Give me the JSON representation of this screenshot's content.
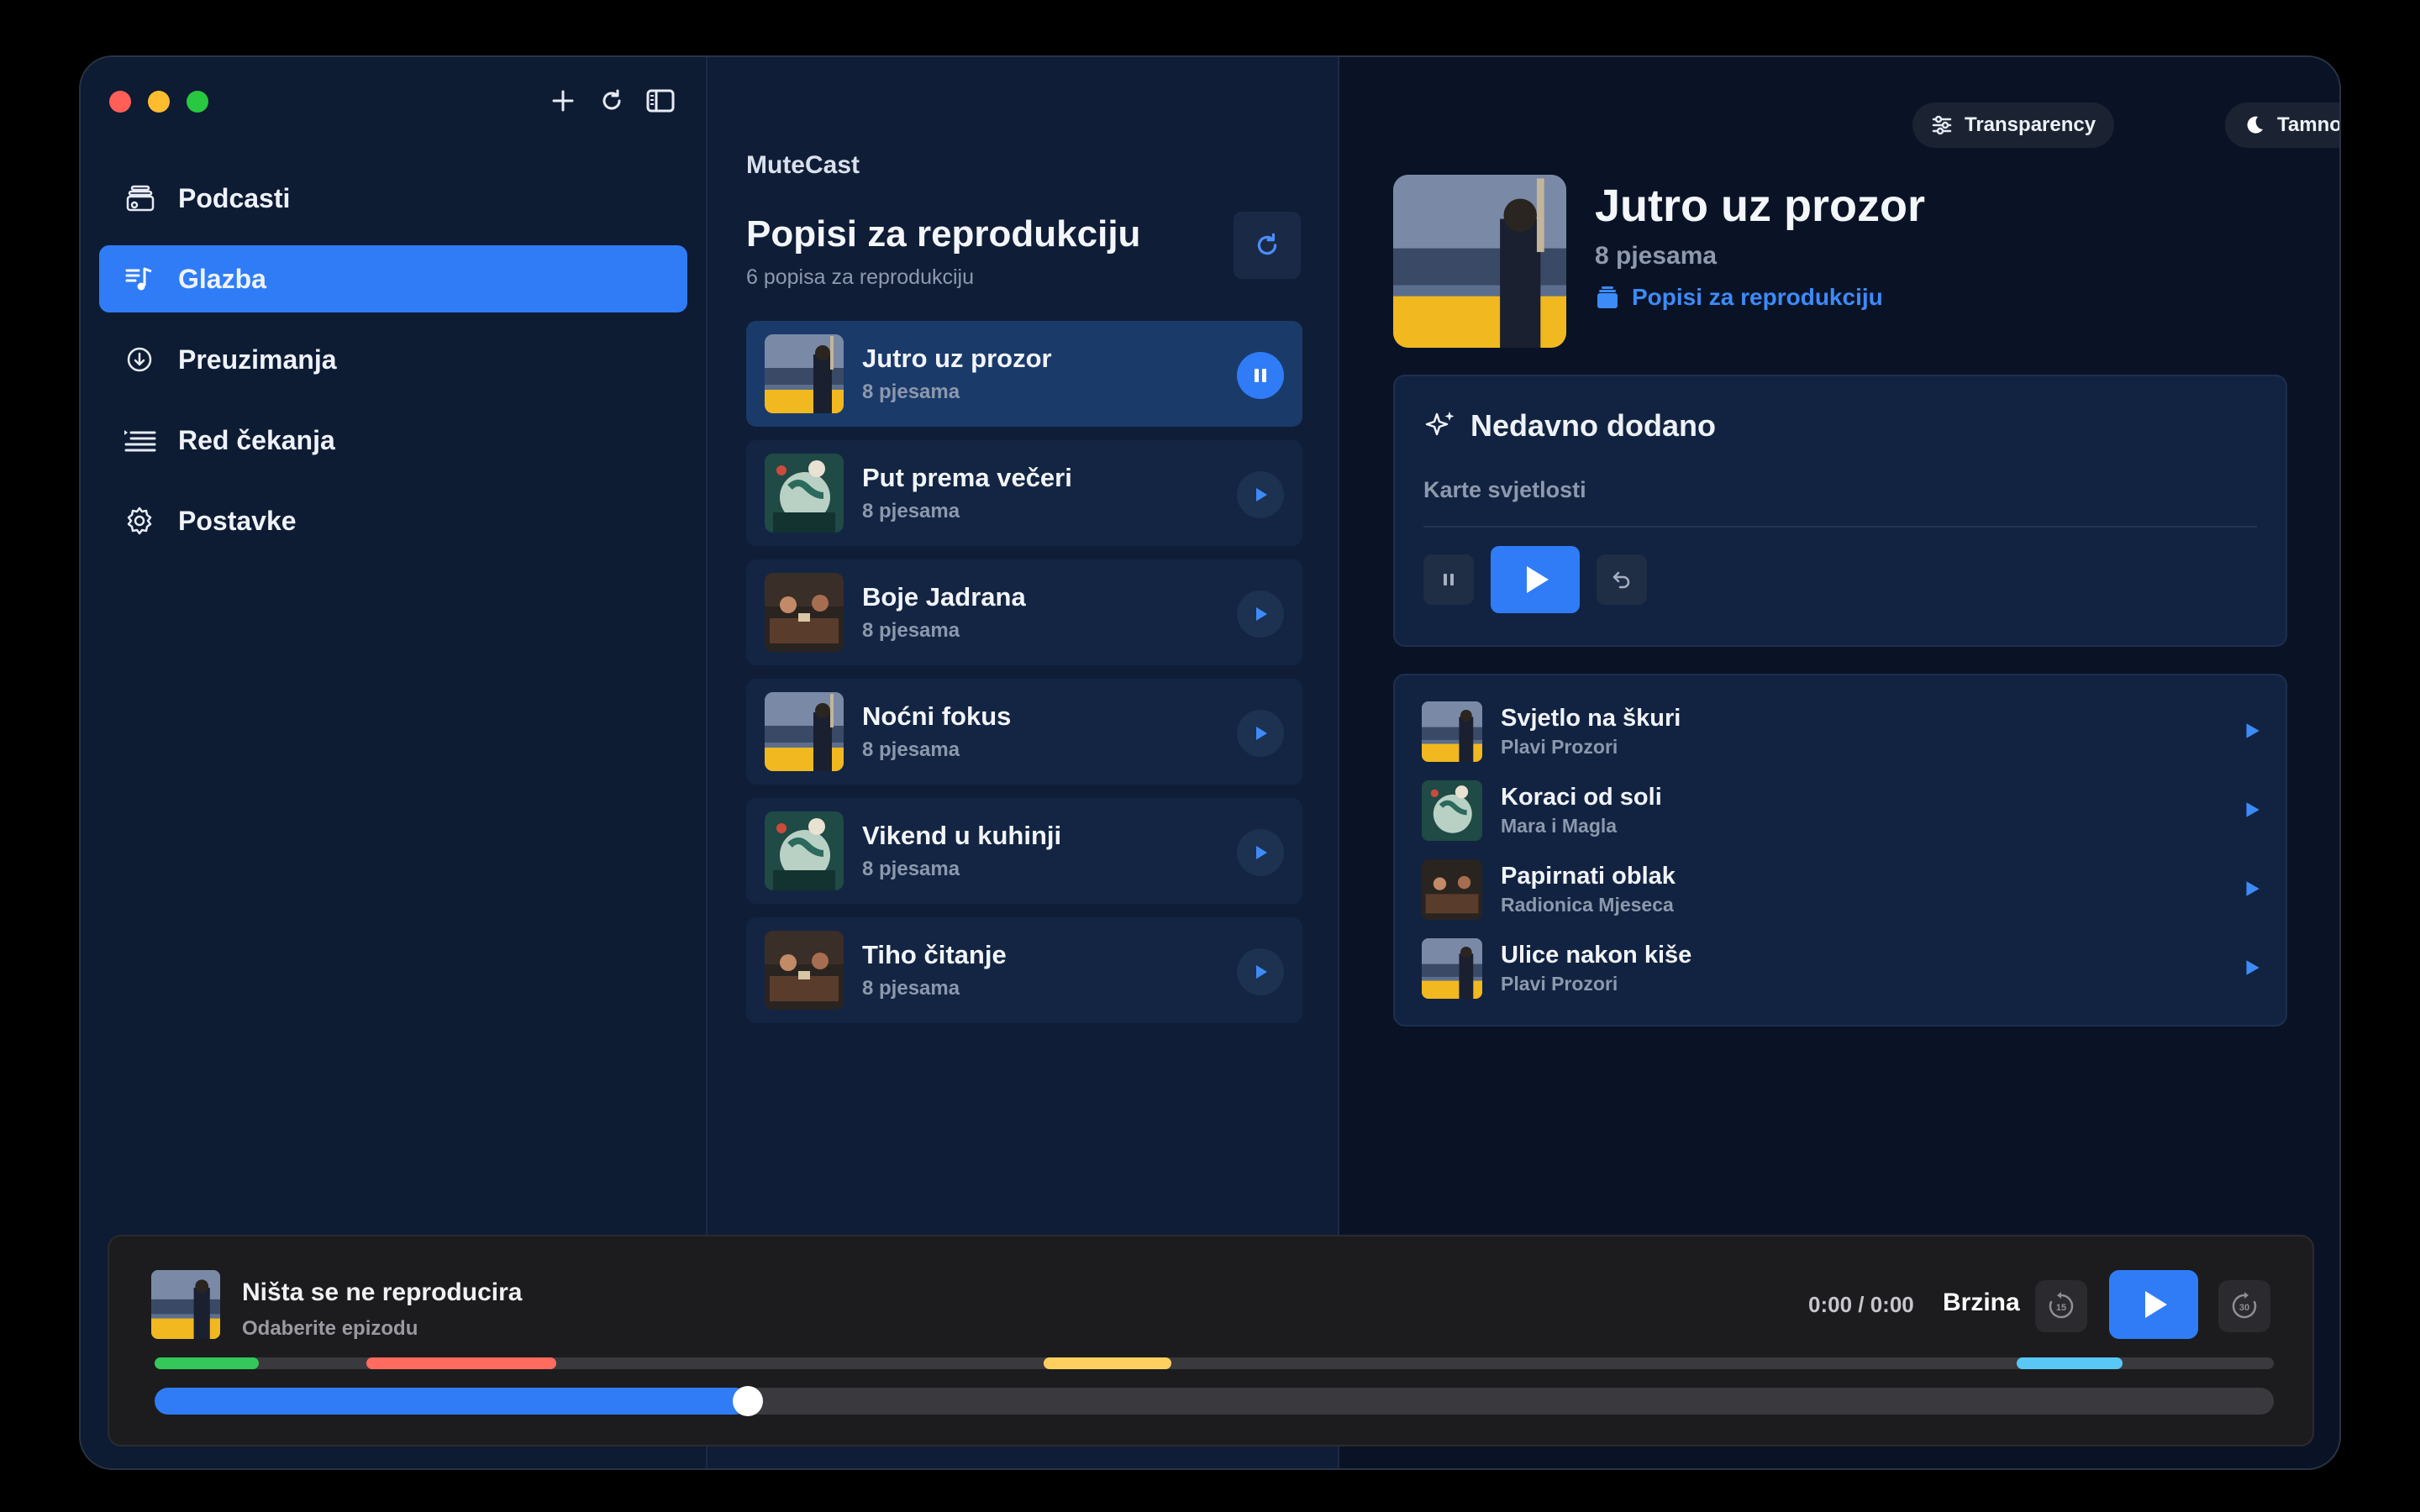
{
  "sidebar": {
    "items": [
      {
        "label": "Podcasti",
        "icon": "podcasts-icon"
      },
      {
        "label": "Glazba",
        "icon": "music-icon",
        "active": true
      },
      {
        "label": "Preuzimanja",
        "icon": "download-icon"
      },
      {
        "label": "Red čekanja",
        "icon": "queue-icon"
      },
      {
        "label": "Postavke",
        "icon": "gear-icon"
      }
    ]
  },
  "middle": {
    "app_name": "MuteCast",
    "title": "Popisi za reprodukciju",
    "subtitle": "6 popisa za reprodukciju",
    "playlists": [
      {
        "name": "Jutro uz prozor",
        "count": "8 pjesama",
        "active": true
      },
      {
        "name": "Put prema večeri",
        "count": "8 pjesama"
      },
      {
        "name": "Boje Jadrana",
        "count": "8 pjesama"
      },
      {
        "name": "Noćni fokus",
        "count": "8 pjesama"
      },
      {
        "name": "Vikend u kuhinji",
        "count": "8 pjesama"
      },
      {
        "name": "Tiho čitanje",
        "count": "8 pjesama"
      }
    ]
  },
  "header": {
    "transparency_label": "Transparency",
    "theme_label": "Tamno"
  },
  "hero": {
    "title": "Jutro uz prozor",
    "subtitle": "8 pjesama",
    "link": "Popisi za reprodukciju"
  },
  "recent": {
    "title": "Nedavno dodano",
    "track": "Karte svjetlosti"
  },
  "tracks": [
    {
      "name": "Svjetlo na škuri",
      "artist": "Plavi Prozori"
    },
    {
      "name": "Koraci od soli",
      "artist": "Mara i Magla"
    },
    {
      "name": "Papirnati oblak",
      "artist": "Radionica Mjeseca"
    },
    {
      "name": "Ulice nakon kiše",
      "artist": "Plavi Prozori"
    }
  ],
  "player": {
    "title": "Ništa se ne reproducira",
    "subtitle": "Odaberite epizodu",
    "time": "0:00 / 0:00",
    "speed_label": "Brzina",
    "skip_back": "15",
    "skip_forward": "30",
    "progress": 0.28
  },
  "colors": {
    "accent": "#2f7cf6",
    "chapters": [
      "#34c759",
      "#ff6b5e",
      "#ffd060",
      "#5ac8f5"
    ]
  }
}
